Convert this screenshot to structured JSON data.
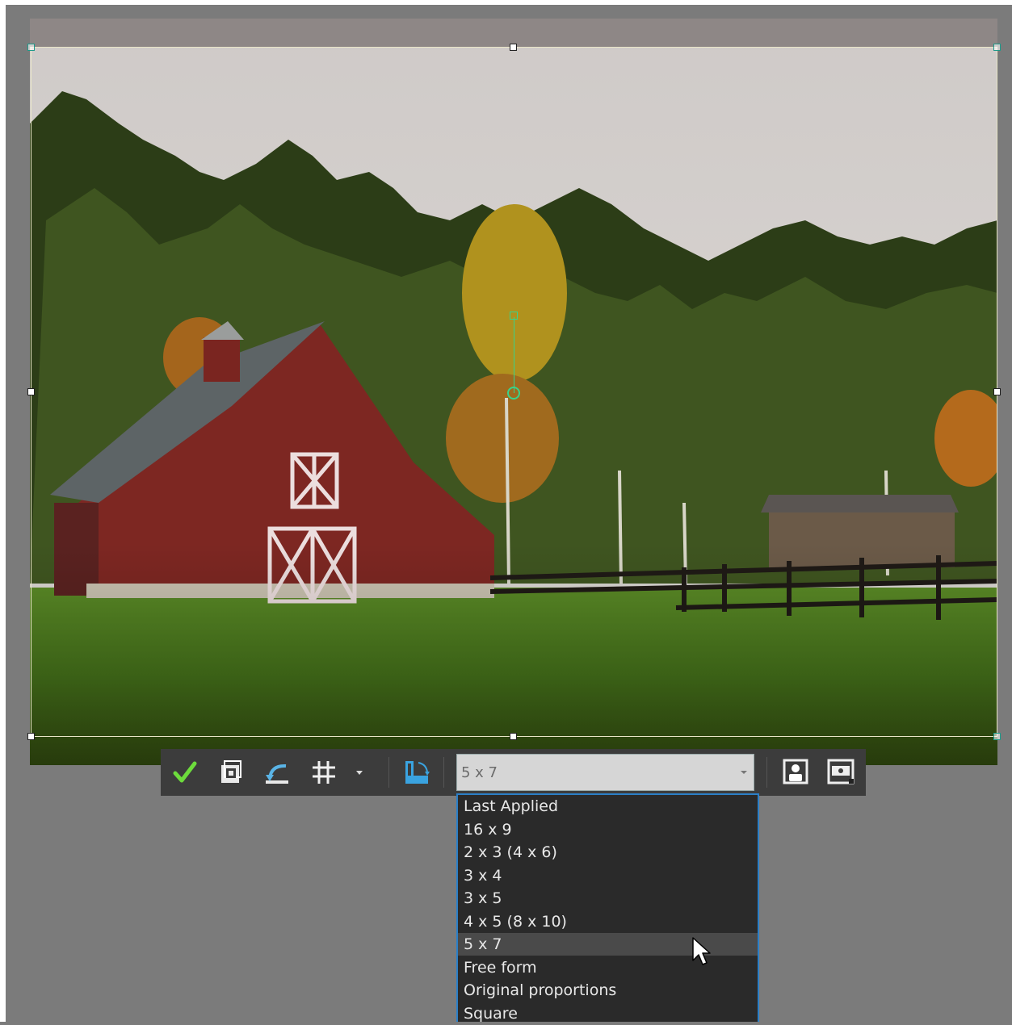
{
  "toolbar": {
    "aspect_ratio_select": {
      "value": "5 x 7"
    },
    "buttons": [
      {
        "name": "apply-checkmark-icon"
      },
      {
        "name": "crop-to-selection-icon"
      },
      {
        "name": "rotate-icon"
      },
      {
        "name": "grid-icon"
      },
      {
        "name": "grid-dropdown-icon"
      },
      {
        "name": "straighten-icon"
      },
      {
        "name": "portrait-orientation-icon"
      },
      {
        "name": "landscape-orientation-icon"
      }
    ]
  },
  "dropdown": {
    "items": [
      {
        "label": " Last Applied"
      },
      {
        "label": "16 x 9"
      },
      {
        "label": "2 x 3 (4 x 6)"
      },
      {
        "label": "3 x 4"
      },
      {
        "label": "3 x 5"
      },
      {
        "label": "4 x 5 (8 x 10)"
      },
      {
        "label": "5 x 7",
        "selected": true
      },
      {
        "label": "Free form"
      },
      {
        "label": "Original proportions"
      },
      {
        "label": "Square"
      }
    ]
  },
  "colors": {
    "accent": "#2b7fc7",
    "apply_check": "#6ddc3c",
    "rotation_handle": "#38d38a",
    "barn_red": "#8a2a25"
  }
}
